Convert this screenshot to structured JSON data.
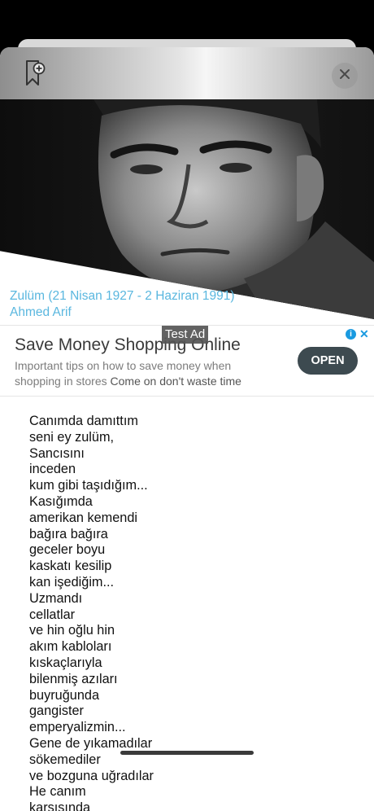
{
  "header": {
    "bookmark_icon": "bookmark-add-icon",
    "close_icon": "close-icon"
  },
  "portrait": {
    "image": "black-and-white-portrait-of-man"
  },
  "caption": {
    "line1": "Zulüm (21 Nisan 1927 - 2 Haziran 1991)",
    "line2": "Ahmed Arif"
  },
  "ad": {
    "badge": "Test Ad",
    "title": "Save Money Shopping Online",
    "body": "Important tips on how to save money when shopping in stores",
    "body_tail": "Come on don't waste time",
    "cta": "OPEN",
    "info_icon": "ad-info-icon",
    "close_icon": "ad-close-icon"
  },
  "poem": {
    "lines": [
      "Canımda damıttım",
      "seni ey zulüm,",
      "Sancısını",
      "inceden",
      "kum gibi taşıdığım...",
      "Kasığımda",
      "amerikan kemendi",
      "bağıra bağıra",
      "geceler boyu",
      "kaskatı kesilip",
      "kan işediğim...",
      "Uzmandı",
      "cellatlar",
      "ve hin oğlu hin",
      "akım kabloları",
      "kıskaçlarıyla",
      "bilenmiş azıları",
      "buyruğunda",
      "gangister",
      "emperyalizmin...",
      "Gene de yıkamadılar",
      "sökemediler",
      "ve bozguna uğradılar",
      "He canım",
      "karşısında"
    ]
  },
  "colors": {
    "caption": "#5ab7df",
    "ad_button": "#3d4a50",
    "ad_info": "#1a9ae0"
  }
}
